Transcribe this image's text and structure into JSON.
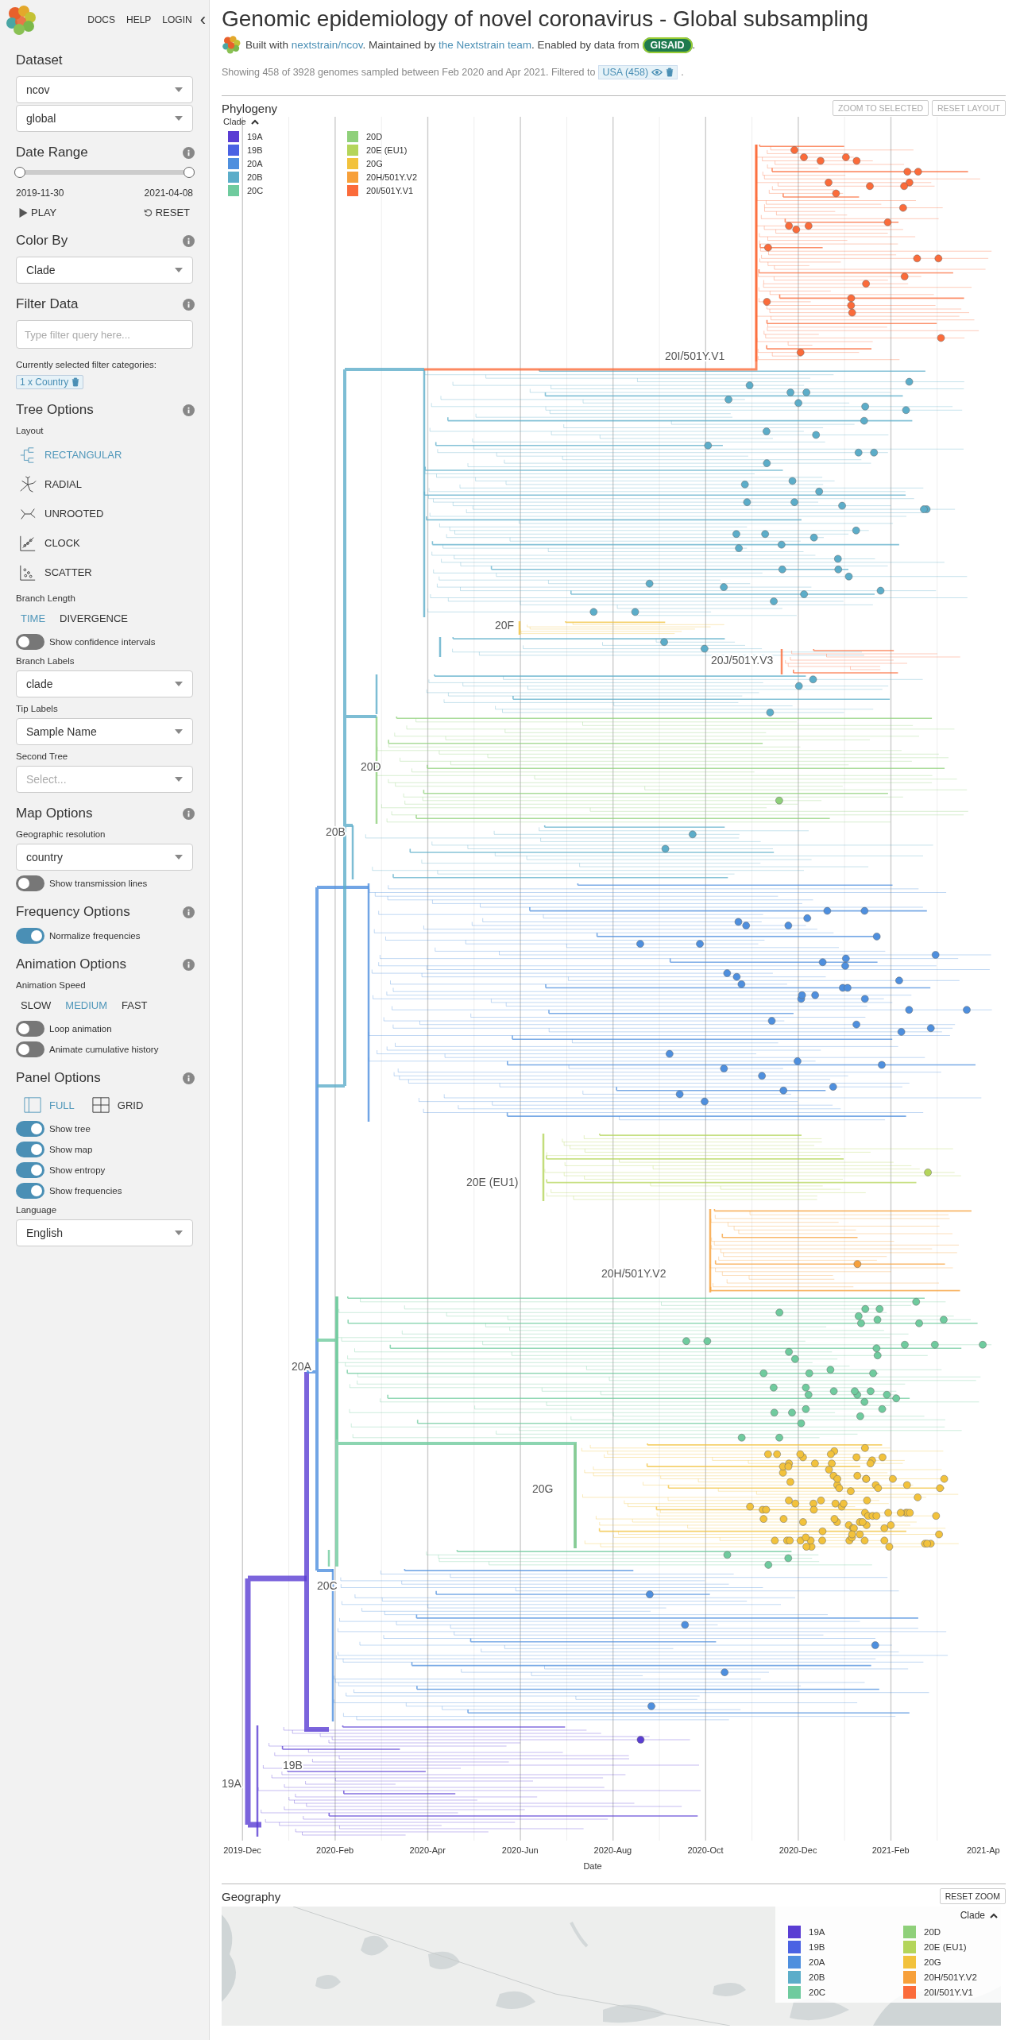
{
  "nav": {
    "links": [
      "DOCS",
      "HELP",
      "LOGIN"
    ],
    "collapse": "‹"
  },
  "sidebar": [
    {
      "title": "Dataset",
      "info": false,
      "items": [
        {
          "kind": "select",
          "value": "ncov"
        },
        {
          "kind": "select",
          "value": "global"
        }
      ]
    },
    {
      "title": "Date Range",
      "info": true,
      "items": [
        {
          "kind": "range",
          "level": 1,
          "start": "2019-11-30",
          "end": "2021-04-08"
        },
        {
          "kind": "actions",
          "buttons": [
            "PLAY",
            "RESET"
          ]
        }
      ]
    },
    {
      "title": "Color By",
      "info": true,
      "items": [
        {
          "kind": "select",
          "value": "Clade"
        }
      ]
    },
    {
      "title": "Filter Data",
      "info": true,
      "items": [
        {
          "kind": "input",
          "placeholder": "Type filter query here..."
        },
        {
          "kind": "label",
          "text": "Currently selected filter categories:"
        },
        {
          "kind": "chip",
          "text": "1 x Country"
        }
      ]
    },
    {
      "title": "Tree Options",
      "info": true,
      "items": [
        {
          "kind": "label",
          "text": "Layout"
        },
        {
          "kind": "layouts",
          "options": [
            {
              "label": "RECTANGULAR",
              "selected": true
            },
            {
              "label": "RADIAL",
              "selected": false
            },
            {
              "label": "UNROOTED",
              "selected": false
            },
            {
              "label": "CLOCK",
              "selected": false
            },
            {
              "label": "SCATTER",
              "selected": false
            }
          ]
        },
        {
          "kind": "label",
          "text": "Branch Length"
        },
        {
          "kind": "choices",
          "options": [
            {
              "label": "TIME",
              "selected": true
            },
            {
              "label": "DIVERGENCE",
              "selected": false
            }
          ]
        },
        {
          "kind": "toggle",
          "label": "Show confidence intervals",
          "on": false
        },
        {
          "kind": "label",
          "text": "Branch Labels"
        },
        {
          "kind": "select",
          "value": "clade"
        },
        {
          "kind": "label",
          "text": "Tip Labels"
        },
        {
          "kind": "select",
          "value": "Sample Name"
        },
        {
          "kind": "label",
          "text": "Second Tree"
        },
        {
          "kind": "select",
          "placeholder": "Select..."
        }
      ]
    },
    {
      "title": "Map Options",
      "info": true,
      "items": [
        {
          "kind": "label",
          "text": "Geographic resolution"
        },
        {
          "kind": "select",
          "value": "country"
        },
        {
          "kind": "toggle",
          "label": "Show transmission lines",
          "on": false
        }
      ]
    },
    {
      "title": "Frequency Options",
      "info": true,
      "items": [
        {
          "kind": "toggle",
          "label": "Normalize frequencies",
          "on": true
        }
      ]
    },
    {
      "title": "Animation Options",
      "info": true,
      "items": [
        {
          "kind": "label",
          "text": "Animation Speed"
        },
        {
          "kind": "choices",
          "options": [
            {
              "label": "SLOW",
              "selected": false
            },
            {
              "label": "MEDIUM",
              "selected": true
            },
            {
              "label": "FAST",
              "selected": false
            }
          ]
        },
        {
          "kind": "toggle",
          "label": "Loop animation",
          "on": false
        },
        {
          "kind": "toggle",
          "label": "Animate cumulative history",
          "on": false
        }
      ]
    },
    {
      "title": "Panel Options",
      "info": true,
      "items": [
        {
          "kind": "panels",
          "options": [
            {
              "label": "FULL",
              "selected": true
            },
            {
              "label": "GRID",
              "selected": false
            }
          ]
        },
        {
          "kind": "toggle",
          "label": "Show tree",
          "on": true
        },
        {
          "kind": "toggle",
          "label": "Show map",
          "on": true
        },
        {
          "kind": "toggle",
          "label": "Show entropy",
          "on": true
        },
        {
          "kind": "toggle",
          "label": "Show frequencies",
          "on": true
        },
        {
          "kind": "label",
          "text": "Language"
        },
        {
          "kind": "select",
          "value": "English"
        }
      ]
    }
  ],
  "title": "Genomic epidemiology of novel coronavirus - Global subsampling",
  "byline": [
    {
      "kind": "text",
      "text": "Built with "
    },
    {
      "kind": "link",
      "text": "nextstrain/ncov"
    },
    {
      "kind": "text",
      "text": ". Maintained by "
    },
    {
      "kind": "link",
      "text": "the Nextstrain team"
    },
    {
      "kind": "text",
      "text": ". Enabled by data from "
    },
    {
      "kind": "badge",
      "text": "GISAID"
    },
    {
      "kind": "text",
      "text": "."
    }
  ],
  "summary": {
    "text": "Showing 458 of 3928 genomes sampled between Feb 2020 and Apr 2021. Filtered to",
    "filter": "USA (458)",
    "end": "."
  },
  "phylogeny": {
    "title": "Phylogeny",
    "buttons": [
      "ZOOM TO SELECTED",
      "RESET LAYOUT"
    ],
    "legend": {
      "title": "Clade",
      "items": [
        {
          "label": "19A",
          "color": "#5a3dd3"
        },
        {
          "label": "19B",
          "color": "#4a62e3"
        },
        {
          "label": "20A",
          "color": "#4e8fde"
        },
        {
          "label": "20B",
          "color": "#5cadc9"
        },
        {
          "label": "20C",
          "color": "#6fcb9e"
        },
        {
          "label": "20D",
          "color": "#8fd07a"
        },
        {
          "label": "20E (EU1)",
          "color": "#b4d55a"
        },
        {
          "label": "20G",
          "color": "#f2c23c"
        },
        {
          "label": "20H/501Y.V2",
          "color": "#f7a03a"
        },
        {
          "label": "20I/501Y.V1",
          "color": "#fb6b3a"
        }
      ]
    },
    "tree_labels": [
      "20I/501Y.V1",
      "20F",
      "20J/501Y.V3",
      "20D",
      "20B",
      "20E (EU1)",
      "20H/501Y.V2",
      "20A",
      "20G",
      "20C",
      "19B",
      "19A"
    ],
    "x_axis": {
      "ticks": [
        "2019-Dec",
        "2020-Feb",
        "2020-Apr",
        "2020-Jun",
        "2020-Aug",
        "2020-Oct",
        "2020-Dec",
        "2021-Feb",
        "2021-Ap"
      ],
      "title": "Date"
    }
  },
  "geography": {
    "title": "Geography",
    "button": "RESET ZOOM",
    "legend": {
      "title": "Clade",
      "items": [
        {
          "label": "19A",
          "color": "#5a3dd3"
        },
        {
          "label": "19B",
          "color": "#4a62e3"
        },
        {
          "label": "20A",
          "color": "#4e8fde"
        },
        {
          "label": "20B",
          "color": "#5cadc9"
        },
        {
          "label": "20C",
          "color": "#6fcb9e"
        },
        {
          "label": "20D",
          "color": "#8fd07a"
        },
        {
          "label": "20E (EU1)",
          "color": "#b4d55a"
        },
        {
          "label": "20G",
          "color": "#f2c23c"
        },
        {
          "label": "20H/501Y.V2",
          "color": "#f7a03a"
        },
        {
          "label": "20I/501Y.V1",
          "color": "#fb6b3a"
        }
      ]
    }
  }
}
